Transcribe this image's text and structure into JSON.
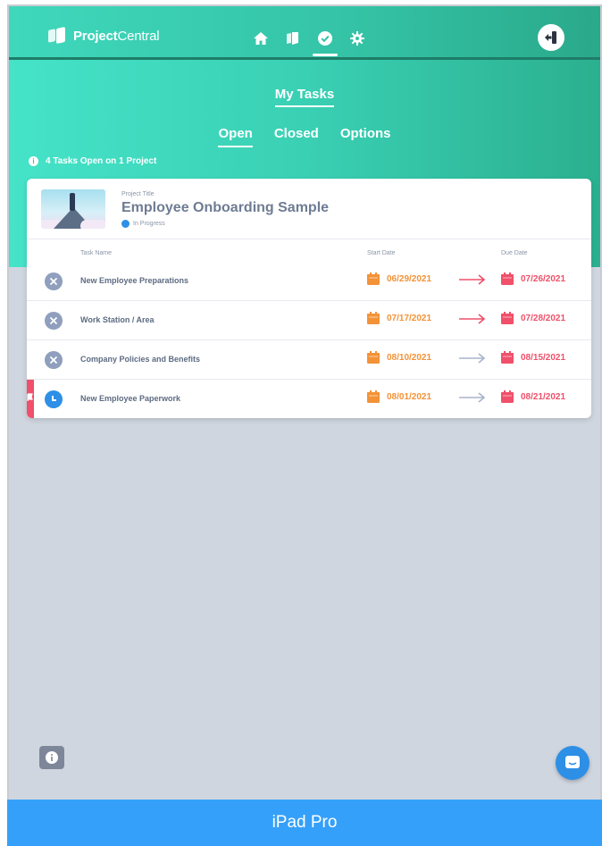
{
  "app": {
    "logo_bold": "Project",
    "logo_light": "Central"
  },
  "nav": [
    {
      "icon": "home-icon"
    },
    {
      "icon": "projects-icon"
    },
    {
      "icon": "tasks-check-icon",
      "active": true
    },
    {
      "icon": "gear-icon"
    }
  ],
  "page": {
    "title": "My Tasks",
    "tabs": [
      "Open",
      "Closed",
      "Options"
    ],
    "active_tab": "Open",
    "summary": "4 Tasks Open on 1 Project"
  },
  "project": {
    "label": "Project Title",
    "name": "Employee Onboarding Sample",
    "status": "In Progress"
  },
  "table": {
    "headers": [
      "Task Name",
      "Start Date",
      "Due Date"
    ],
    "rows": [
      {
        "name": "New Employee Preparations",
        "start": "06/29/2021",
        "due": "07/26/2021",
        "state": "closed",
        "overdue": true,
        "flag": false
      },
      {
        "name": "Work Station / Area",
        "start": "07/17/2021",
        "due": "07/28/2021",
        "state": "closed",
        "overdue": true,
        "flag": false
      },
      {
        "name": "Company Policies and Benefits",
        "start": "08/10/2021",
        "due": "08/15/2021",
        "state": "closed",
        "overdue": false,
        "flag": false
      },
      {
        "name": "New Employee Paperwork",
        "start": "08/01/2021",
        "due": "08/21/2021",
        "state": "open",
        "overdue": false,
        "flag": true
      }
    ]
  },
  "colors": {
    "start_date": "#f39237",
    "due_date": "#f0506a",
    "arrow_overdue": "#f0506a",
    "arrow_normal": "#a9b4cc",
    "accent": "#2d8fe6"
  },
  "device": {
    "label": "iPad Pro"
  }
}
